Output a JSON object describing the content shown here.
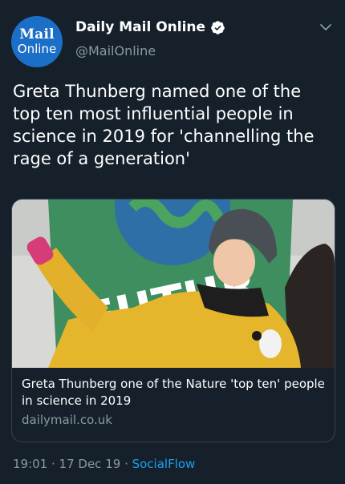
{
  "header": {
    "avatar_line1": "Mail",
    "avatar_line2": "Online",
    "display_name": "Daily Mail Online",
    "handle": "@MailOnline"
  },
  "tweet": {
    "text": "Greta Thunberg named one of the top ten most influential people in science in 2019 for 'channelling the rage of a generation'"
  },
  "card": {
    "image_banner_text": "FUTUR",
    "title": "Greta Thunberg one of the Nature 'top ten' people in science in 2019",
    "domain": "dailymail.co.uk"
  },
  "meta": {
    "time": "19:01",
    "sep1": " · ",
    "date": "17 Dec 19",
    "sep2": " · ",
    "source": "SocialFlow"
  },
  "colors": {
    "background": "#15202b",
    "secondary_text": "#8899a6",
    "link": "#1da1f2",
    "border": "#38444d"
  }
}
